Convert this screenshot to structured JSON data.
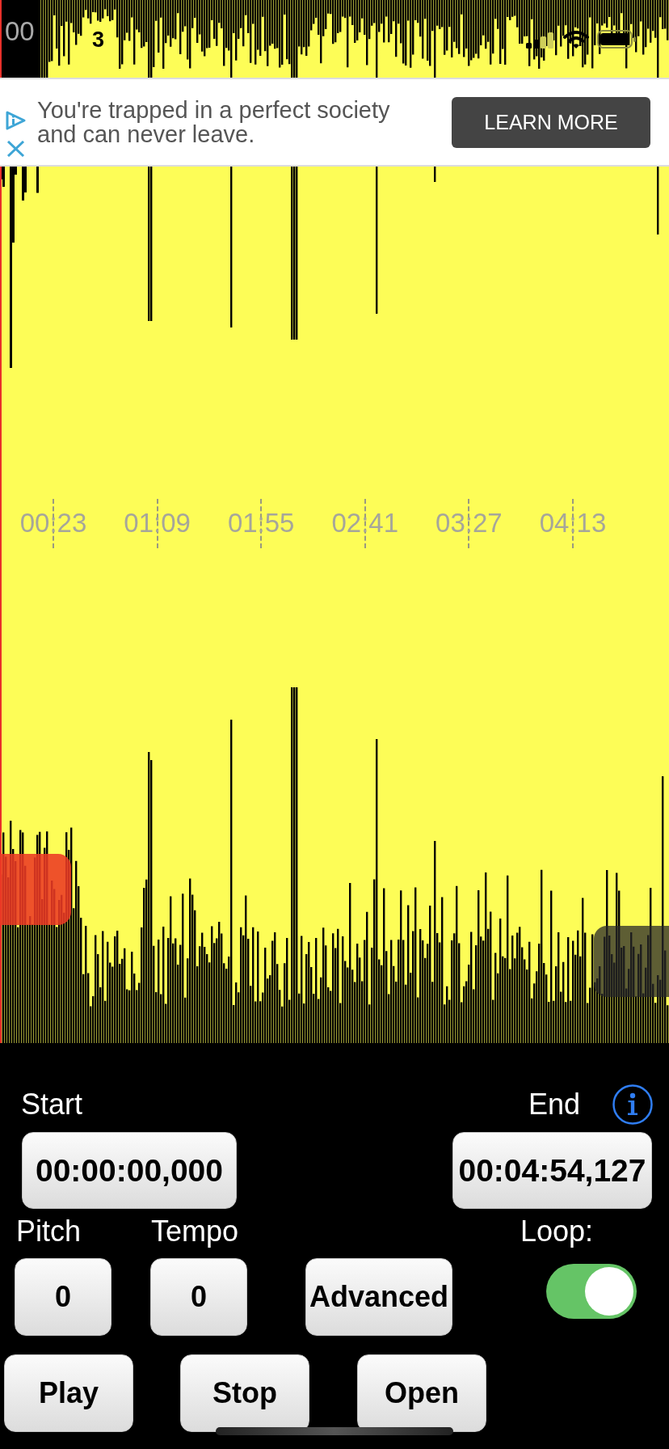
{
  "status_bar": {
    "overlay_label": "00",
    "time": "3"
  },
  "ad": {
    "text": "You're trapped in a perfect society and can never leave.",
    "button": "LEARN MORE"
  },
  "timeline": {
    "marks": [
      "00:23",
      "01:09",
      "01:55",
      "02:41",
      "03:27",
      "04:13"
    ]
  },
  "start": {
    "label": "Start",
    "value": "00:00:00,000"
  },
  "end": {
    "label": "End",
    "value": "00:04:54,127"
  },
  "pitch": {
    "label": "Pitch",
    "value": "0"
  },
  "tempo": {
    "label": "Tempo",
    "value": "0"
  },
  "advanced": {
    "label": "Advanced"
  },
  "loop": {
    "label": "Loop:",
    "on": true
  },
  "transport": [
    {
      "label": "Play"
    },
    {
      "label": "Stop"
    },
    {
      "label": "Open"
    }
  ]
}
